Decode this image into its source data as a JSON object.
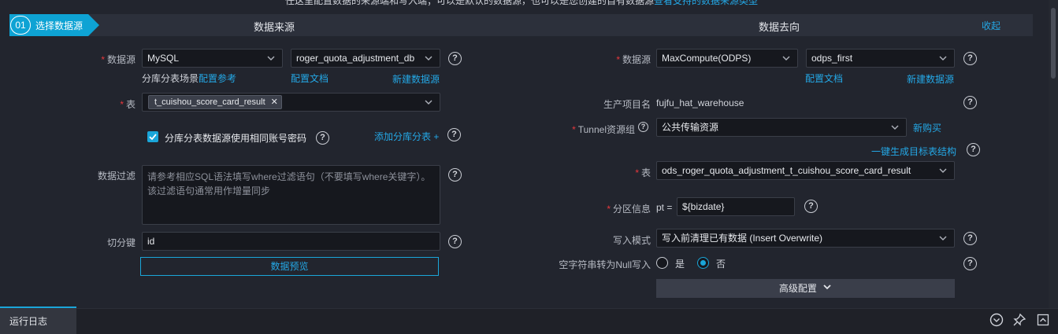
{
  "top_cut_text": "任这里配置数据的来源端和写入端；可以是默认的数据源，也可以是您创建的自有数据源",
  "top_cut_link": "查看支持的数据来源类型",
  "step": {
    "number": "01",
    "label": "选择数据源"
  },
  "source": {
    "title": "数据来源",
    "datasource_label": "数据源",
    "datasource_type": "MySQL",
    "datasource_name": "roger_quota_adjustment_db",
    "sharding_text": "分库分表场景",
    "sharding_link": "配置参考",
    "config_doc": "配置文档",
    "new_datasource": "新建数据源",
    "table_label": "表",
    "table_tag": "t_cuishou_score_card_result",
    "same_account_label": "分库分表数据源使用相同账号密码",
    "add_shard_link": "添加分库分表 +",
    "filter_label": "数据过滤",
    "filter_placeholder": "请参考相应SQL语法填写where过滤语句（不要填写where关键字）。该过滤语句通常用作增量同步",
    "split_key_label": "切分键",
    "split_key_value": "id",
    "preview_button": "数据预览"
  },
  "target": {
    "title": "数据去向",
    "collapse": "收起",
    "datasource_label": "数据源",
    "datasource_type": "MaxCompute(ODPS)",
    "datasource_name": "odps_first",
    "config_doc": "配置文档",
    "new_datasource": "新建数据源",
    "project_label": "生产项目名",
    "project_value": "fujfu_hat_warehouse",
    "tunnel_label": "Tunnel资源组",
    "tunnel_value": "公共传输资源",
    "buy_new": "新购买",
    "gen_table_link": "一键生成目标表结构",
    "table_label": "表",
    "table_value": "ods_roger_quota_adjustment_t_cuishou_score_card_result",
    "partition_label": "分区信息",
    "partition_prefix": "pt =",
    "partition_value": "${bizdate}",
    "write_mode_label": "写入模式",
    "write_mode_value": "写入前清理已有数据 (Insert Overwrite)",
    "null_label": "空字符串转为Null写入",
    "null_yes": "是",
    "null_no": "否",
    "null_selected": "否",
    "advanced_button": "高级配置"
  },
  "bottom": {
    "log_tab": "运行日志"
  },
  "colors": {
    "accent": "#1aa6d9",
    "link": "#24a8e6",
    "required": "#e8383d",
    "background": "#22252e"
  }
}
